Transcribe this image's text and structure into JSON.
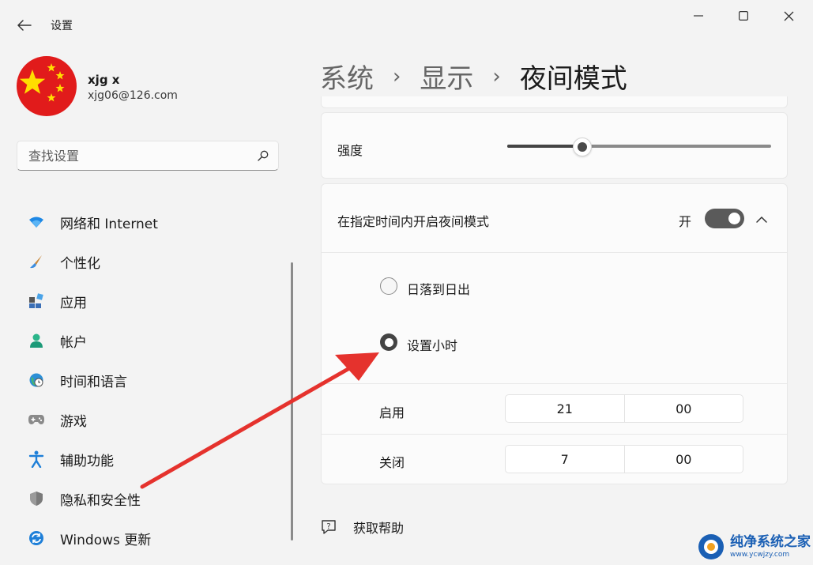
{
  "window": {
    "title": "设置"
  },
  "user": {
    "name": "xjg x",
    "email": "xjg06@126.com"
  },
  "search": {
    "placeholder": "查找设置"
  },
  "sidebar": {
    "items": [
      {
        "label": "网络和 Internet",
        "icon": "wifi-icon"
      },
      {
        "label": "个性化",
        "icon": "brush-icon"
      },
      {
        "label": "应用",
        "icon": "apps-icon"
      },
      {
        "label": "帐户",
        "icon": "person-icon"
      },
      {
        "label": "时间和语言",
        "icon": "globe-clock-icon"
      },
      {
        "label": "游戏",
        "icon": "gamepad-icon"
      },
      {
        "label": "辅助功能",
        "icon": "accessibility-icon"
      },
      {
        "label": "隐私和安全性",
        "icon": "shield-icon"
      },
      {
        "label": "Windows 更新",
        "icon": "update-icon"
      }
    ]
  },
  "breadcrumb": {
    "level1": "系统",
    "level2": "显示",
    "current": "夜间模式",
    "separator": "›"
  },
  "intensity": {
    "label": "强度",
    "value_percent": 28
  },
  "schedule": {
    "label": "在指定时间内开启夜间模式",
    "toggle_state_label": "开",
    "toggle_on": true,
    "options": [
      {
        "label": "日落到日出",
        "selected": false
      },
      {
        "label": "设置小时",
        "selected": true
      }
    ],
    "turn_on": {
      "label": "启用",
      "hour": "21",
      "minute": "00"
    },
    "turn_off": {
      "label": "关闭",
      "hour": "7",
      "minute": "00"
    }
  },
  "help": {
    "label": "获取帮助"
  },
  "watermark": {
    "title": "纯净系统之家",
    "url": "www.ycwjzy.com"
  },
  "colors": {
    "accent": "#444444",
    "annotation_arrow": "#e5322d",
    "watermark": "#1a5fb4"
  }
}
